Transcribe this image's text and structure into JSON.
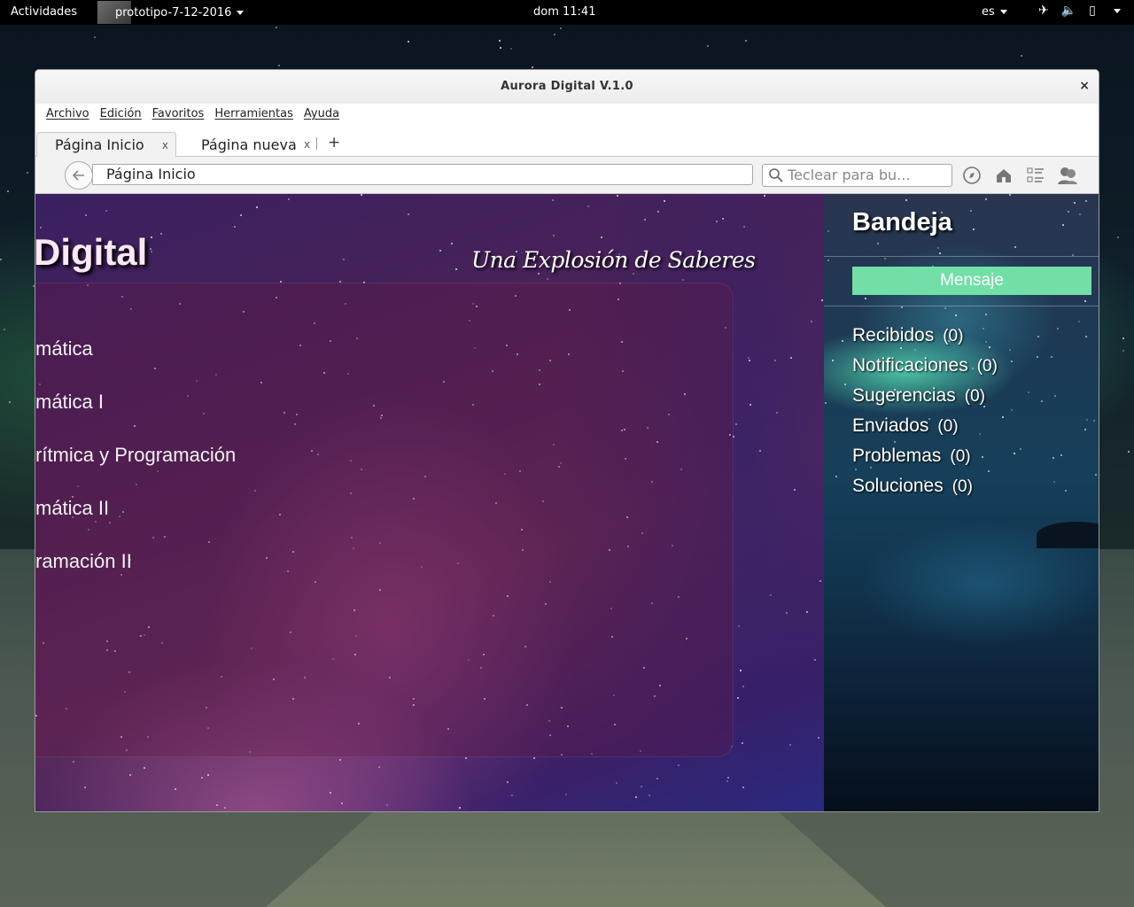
{
  "topbar": {
    "activities": "Actividades",
    "app_name": "prototipo-7-12-2016",
    "clock": "dom 11:41",
    "lang": "es"
  },
  "window": {
    "title": "Aurora Digital V.1.0",
    "close_label": "×"
  },
  "menubar": {
    "items": [
      "Archivo",
      "Edición",
      "Favoritos",
      "Herramientas",
      "Ayuda"
    ]
  },
  "tabs": [
    {
      "label": "Página Inicio",
      "close": "x",
      "active": true
    },
    {
      "label": "Página nueva",
      "close": "x",
      "active": false
    }
  ],
  "new_tab_label": "+",
  "navbar": {
    "back_icon": "arrow-left-icon",
    "url_value": "Página Inicio",
    "search_placeholder": "Teclear para bu..."
  },
  "page": {
    "site_title": "Digital",
    "slogan": "Una Explosión de Saberes",
    "subjects": [
      "mática",
      "mática I",
      "rítmica y Programación",
      "mática II",
      "ramación II"
    ]
  },
  "sidebar": {
    "title": "Bandeja",
    "button_label": "Mensaje",
    "button_color": "#72dfa8",
    "items": [
      {
        "label": "Recibidos",
        "count": "(0)"
      },
      {
        "label": "Notificaciones",
        "count": "(0)"
      },
      {
        "label": "Sugerencias",
        "count": "(0)"
      },
      {
        "label": "Enviados",
        "count": "(0)"
      },
      {
        "label": "Problemas",
        "count": "(0)"
      },
      {
        "label": "Soluciones",
        "count": "(0)"
      }
    ]
  }
}
